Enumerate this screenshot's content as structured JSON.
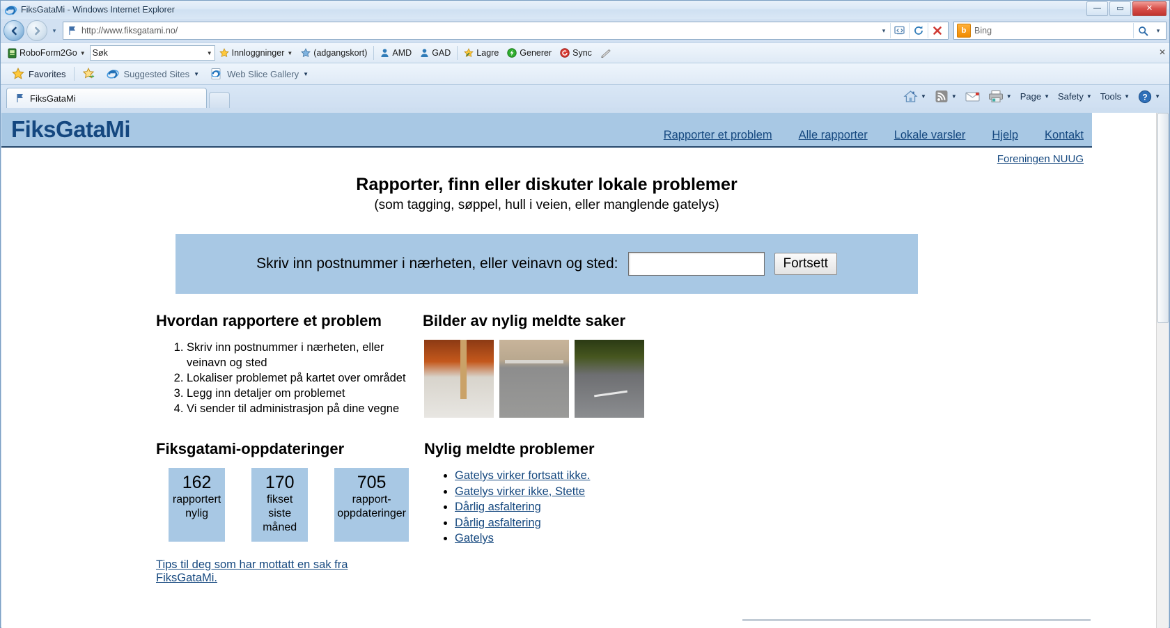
{
  "browser": {
    "title": "FiksGataMi - Windows Internet Explorer",
    "ie_icon": "internet-explorer-icon",
    "window_buttons": {
      "minimize": "—",
      "maximize": "▭",
      "close": "✕"
    },
    "nav": {
      "back": "back-icon",
      "forward": "forward-icon",
      "recent_pages": "▾"
    },
    "address": {
      "url": "http://www.fiksgatami.no/",
      "dropdown": "▾",
      "compatibility": "compatibility-view-icon",
      "refresh": "refresh-icon",
      "stop": "✕"
    },
    "search": {
      "provider": "Bing",
      "placeholder": "Bing",
      "icon": "bing-icon",
      "go": "search-icon"
    },
    "roboform": {
      "menu": "RoboForm2Go",
      "search_placeholder": "Søk",
      "logins": "Innloggninger",
      "passcard": "(adgangskort)",
      "items": [
        {
          "label": "AMD",
          "icon": "passcard-icon"
        },
        {
          "label": "GAD",
          "icon": "passcard-icon"
        },
        {
          "label": "Lagre",
          "icon": "save-icon"
        },
        {
          "label": "Generer",
          "icon": "generate-icon"
        },
        {
          "label": "Sync",
          "icon": "sync-icon"
        }
      ],
      "pencil": "pencil-icon",
      "close": "✕"
    },
    "favorites_bar": {
      "favorites": "Favorites",
      "suggested_sites": "Suggested Sites",
      "web_slice_gallery": "Web Slice Gallery"
    },
    "tabs": [
      {
        "label": "FiksGataMi"
      }
    ],
    "new_tab": "new-tab-button",
    "command_bar": {
      "home": "home-icon",
      "feeds": "feeds-icon",
      "mail": "mail-icon",
      "print": "print-icon",
      "page": "Page",
      "safety": "Safety",
      "tools": "Tools",
      "help": "help-icon"
    }
  },
  "site": {
    "logo": "FiksGataMi",
    "nav": [
      {
        "label": "Rapporter et problem"
      },
      {
        "label": "Alle rapporter"
      },
      {
        "label": "Lokale varsler"
      },
      {
        "label": "Hjelp"
      },
      {
        "label": "Kontakt"
      }
    ],
    "org_link": "Foreningen NUUG",
    "heading": "Rapporter, finn eller diskuter lokale problemer",
    "subheading": "(som tagging, søppel, hull i veien, eller manglende gatelys)",
    "search_panel": {
      "label": "Skriv inn postnummer i nærheten, eller veinavn og sted:",
      "value": "",
      "placeholder": "",
      "button": "Fortsett"
    },
    "how_to": {
      "heading": "Hvordan rapportere et problem",
      "steps": [
        "Skriv inn postnummer i nærheten, eller veinavn og sted",
        "Lokaliser problemet på kartet over området",
        "Legg inn detaljer om problemet",
        "Vi sender til administrasjon på dine vegne"
      ]
    },
    "updates": {
      "heading": "Fiksgatami-oppdateringer",
      "stats": [
        {
          "number": "162",
          "caption": "rapportert nylig"
        },
        {
          "number": "170",
          "caption": "fikset siste måned"
        },
        {
          "number": "705",
          "caption": "rapport-oppdateringer"
        }
      ],
      "tip_link": "Tips til deg som har mottatt en sak fra FiksGataMi."
    },
    "photos": {
      "heading": "Bilder av nylig meldte saker",
      "items": [
        {
          "alt": "photo-snow-pole"
        },
        {
          "alt": "photo-street-building"
        },
        {
          "alt": "photo-road-dusk"
        }
      ]
    },
    "recent": {
      "heading": "Nylig meldte problemer",
      "items": [
        "Gatelys virker fortsatt ikke.",
        "Gatelys virker ikke, Stette",
        "Dårlig asfaltering",
        "Dårlig asfaltering",
        "Gatelys"
      ]
    }
  },
  "colors": {
    "site_blue": "#a8c8e4",
    "link_blue": "#15487f",
    "header_border": "#26486b"
  }
}
